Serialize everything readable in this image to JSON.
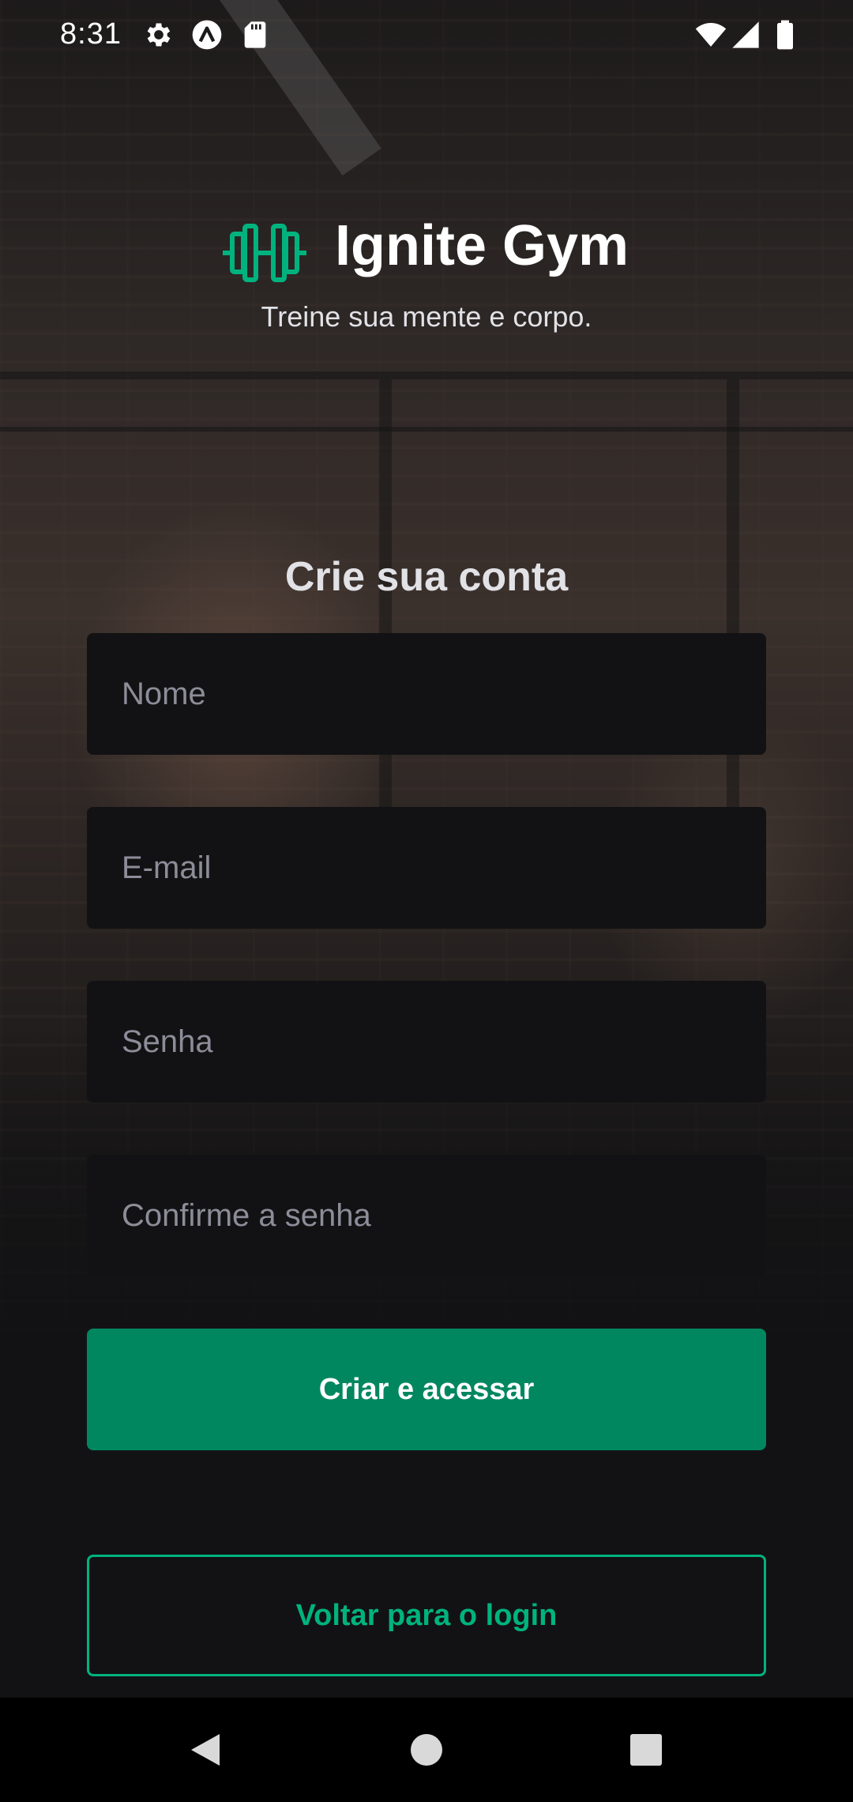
{
  "status_bar": {
    "time": "8:31",
    "icons": [
      "settings-icon",
      "app-a-icon",
      "sd-card-icon",
      "wifi-icon",
      "signal-icon",
      "battery-icon"
    ]
  },
  "header": {
    "logo_icon": "dumbbell-icon",
    "title": "Ignite Gym",
    "tagline": "Treine sua mente e corpo."
  },
  "form": {
    "title": "Crie sua conta",
    "fields": [
      {
        "placeholder": "Nome",
        "value": ""
      },
      {
        "placeholder": "E-mail",
        "value": ""
      },
      {
        "placeholder": "Senha",
        "value": ""
      },
      {
        "placeholder": "Confirme a senha",
        "value": ""
      }
    ],
    "submit_label": "Criar e acessar",
    "back_label": "Voltar para o login"
  },
  "nav_bar": {
    "buttons": [
      "back-icon",
      "home-icon",
      "recents-icon"
    ]
  },
  "colors": {
    "accent": "#00b37e",
    "button": "#00875f",
    "input_bg": "#121214",
    "placeholder": "#8d8d99",
    "background": "#121214"
  }
}
